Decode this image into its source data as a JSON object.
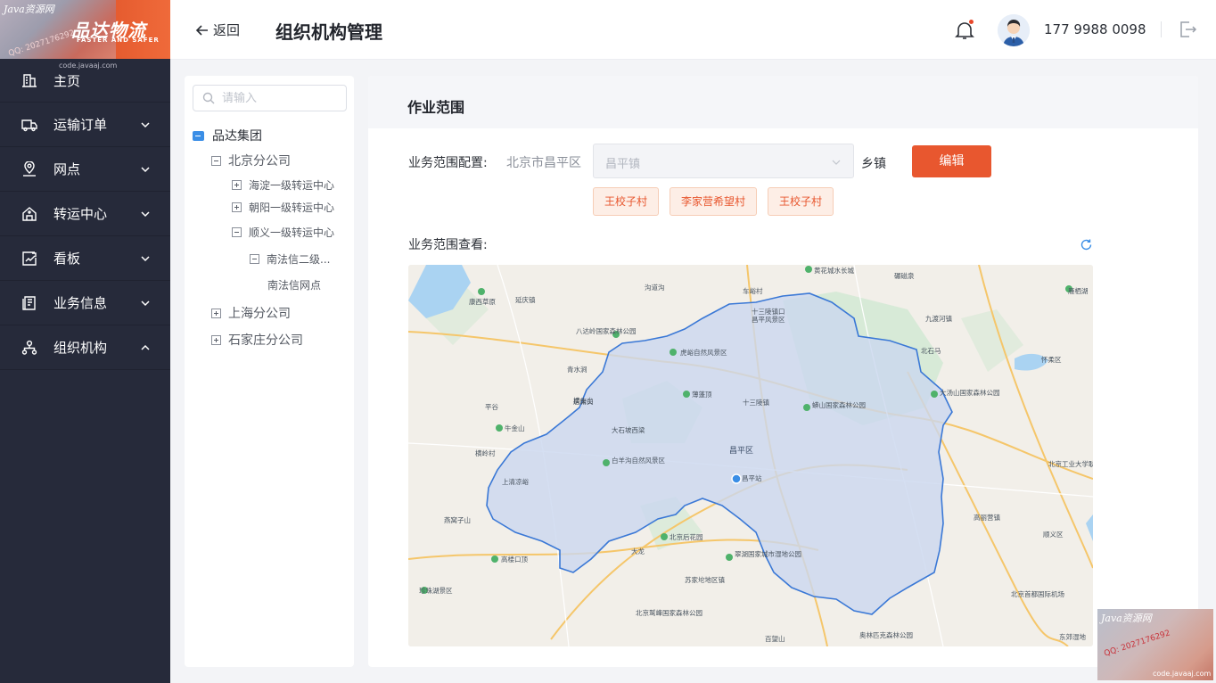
{
  "brand": {
    "name": "品达物流",
    "tagline": "FASTER AND SAFER",
    "watermark_title": "Java资源网",
    "watermark_qq": "QQ: 2027176292",
    "watermark_url": "code.javaaj.com"
  },
  "sidebar": {
    "items": [
      {
        "label": "主页",
        "icon": "home-icon",
        "expanded": null
      },
      {
        "label": "运输订单",
        "icon": "truck-icon",
        "expanded": false
      },
      {
        "label": "网点",
        "icon": "location-pin-icon",
        "expanded": false
      },
      {
        "label": "转运中心",
        "icon": "warehouse-icon",
        "expanded": false
      },
      {
        "label": "看板",
        "icon": "dashboard-icon",
        "expanded": false
      },
      {
        "label": "业务信息",
        "icon": "document-icon",
        "expanded": false
      },
      {
        "label": "组织机构",
        "icon": "org-chart-icon",
        "expanded": true
      }
    ]
  },
  "header": {
    "back_label": "返回",
    "title": "组织机构管理",
    "phone": "177 9988 0098"
  },
  "tree": {
    "search_placeholder": "请输入",
    "nodes": [
      {
        "label": "品达集团"
      },
      {
        "label": "北京分公司"
      },
      {
        "label": "海淀一级转运中心"
      },
      {
        "label": "朝阳一级转运中心"
      },
      {
        "label": "顺义一级转运中心"
      },
      {
        "label": "南法信二级..."
      },
      {
        "label": "南法信网点"
      },
      {
        "label": "上海分公司"
      },
      {
        "label": "石家庄分公司"
      }
    ]
  },
  "main": {
    "section_title": "作业范围",
    "config_label": "业务范围配置:",
    "district": "北京市昌平区",
    "town_value": "昌平镇",
    "town_unit": "乡镇",
    "edit_label": "编辑",
    "villages": [
      "王校子村",
      "李家营希望村",
      "王校子村"
    ],
    "view_label": "业务范围查看:"
  },
  "map": {
    "district_center": "昌平区",
    "labels": [
      "黄花城水长城",
      "碾磁泉",
      "康西草原",
      "延庆镇",
      "沟道沟",
      "车峪村",
      "十三陵镇口",
      "昌平风景区",
      "八达岭国家森林公园",
      "雁栖湖",
      "虎峪自然风景区",
      "九渡河镇",
      "北石马",
      "怀柔区",
      "青水涧",
      "居庸关",
      "大汤山国家森林公园",
      "蟒山国家森林公园",
      "十三陵镇",
      "薄蓬顶",
      "横头山",
      "大石坡西梁",
      "平谷",
      "牛金山",
      "北京工业大学耿丹学院",
      "白羊沟自然风景区",
      "昌平站",
      "上清凉峪",
      "横岭村",
      "燕窝子山",
      "北京后花园",
      "高丽营镇",
      "顺义区",
      "大龙",
      "高楼口顶",
      "翠湖国家城市湿地公园",
      "珍珠湖景区",
      "北京首都国际机场",
      "苏家坨地区镇",
      "北京鹫峰国家森林公园",
      "百望山",
      "奥林匹克森林公园",
      "东郊湿地"
    ]
  }
}
